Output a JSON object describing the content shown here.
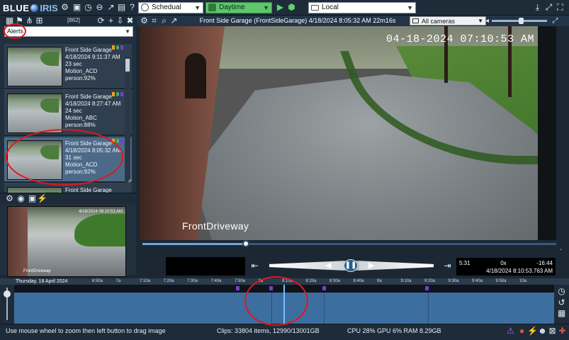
{
  "app": {
    "name_left": "BLUE",
    "name_right": "IRIS"
  },
  "toolbar": {
    "schedule": "Schedual",
    "profile": "Daytime",
    "server": "Local"
  },
  "left_panel": {
    "count": "[862]",
    "filter": "Alerts",
    "alerts": [
      {
        "camera": "Front Side Garage",
        "date": "4/18/2024 9:11:37 AM",
        "duration": "23 sec",
        "trigger": "Motion_ACD",
        "detection": "person:92%"
      },
      {
        "camera": "Front Side Garage",
        "date": "4/18/2024 8:27:47 AM",
        "duration": "24 sec",
        "trigger": "Motion_ABC",
        "detection": "person:88%"
      },
      {
        "camera": "Front Side Garage",
        "date": "4/18/2024 8:05:32 AM",
        "duration": "31 sec",
        "trigger": "Motion_ACD",
        "detection": "person:92%"
      },
      {
        "camera": "Front Side Garage",
        "date": "",
        "duration": "",
        "trigger": "",
        "detection": ""
      }
    ],
    "preview_caption": "4/18/2024 08:10:53 AM",
    "preview_label": "FrontDriveway"
  },
  "camera": {
    "title": "Front Side Garage (FrontSideGarage) 4/18/2024 8:05:32 AM  22m16s",
    "all_cameras": "All cameras",
    "overlay_timestamp": "04-18-2024 07:10:53 AM",
    "overlay_name": "FrontDriveway"
  },
  "playback": {
    "progress": 0.25,
    "elapsed": "5:31",
    "speed": "0x",
    "remaining": "-16:44",
    "position_time": "4/18/2024 8:10:53.763 AM"
  },
  "timeline": {
    "date": "Thursday, 18 April 2024",
    "ticks": [
      "6:50a",
      "7a",
      "7:10a",
      "7:20a",
      "7:30a",
      "7:40a",
      "7:50a",
      "8a",
      "8:10a",
      "8:20a",
      "8:30a",
      "8:40a",
      "9a",
      "9:10a",
      "9:20a",
      "9:30a",
      "9:40a",
      "9:50a",
      "10a"
    ]
  },
  "status": {
    "hint": "Use mouse wheel to zoom then left button to drag image",
    "clips": "Clips: 33804 items, 12990/13001GB",
    "resources": "CPU 28% GPU 6% RAM 8.29GB"
  },
  "colors": {
    "accent": "#3d6ea0",
    "annotation": "#e2161e",
    "profile_green": "#5cc86a",
    "flag_purple": "#7b3bd6"
  }
}
